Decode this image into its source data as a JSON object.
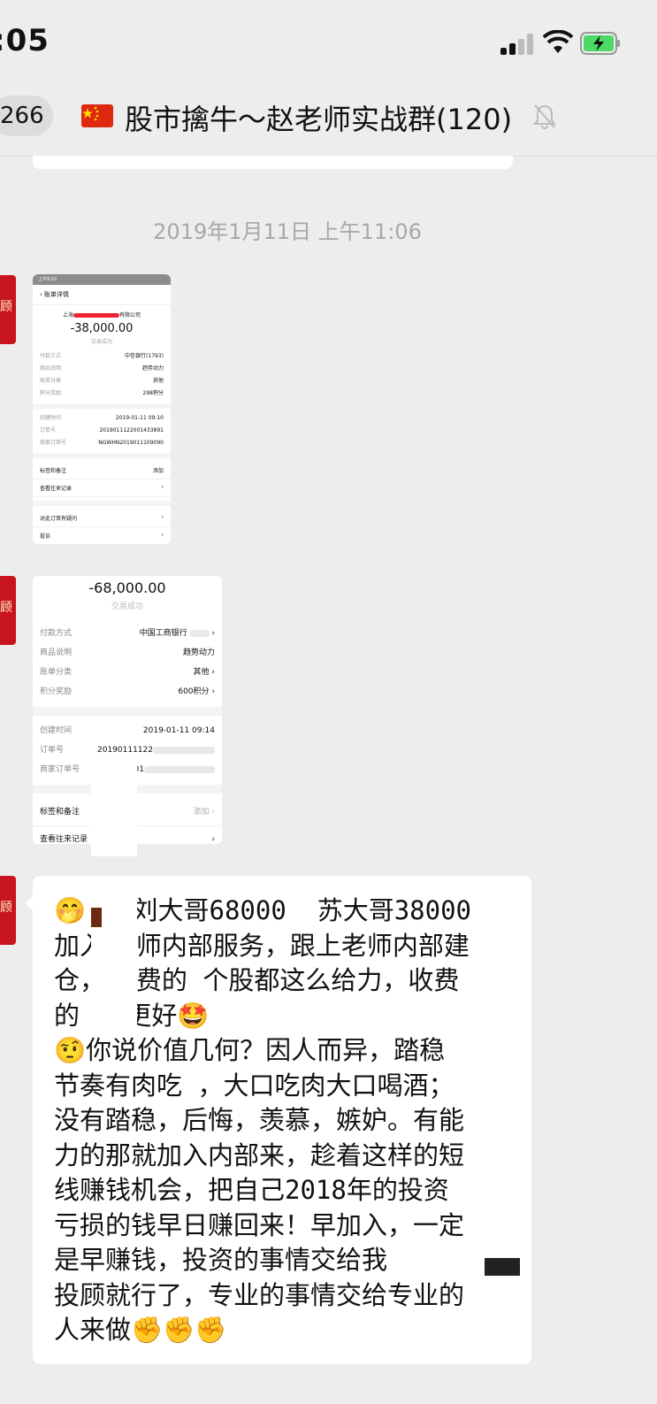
{
  "status_bar": {
    "time": ":05"
  },
  "nav": {
    "unread_count": "266",
    "flag_icon": "china-flag-icon",
    "title": "股市擒牛～赵老师实战群(120)",
    "mute_icon": "bell-muted-icon"
  },
  "timestamp": "2019年1月11日 上午11:06",
  "receipt1": {
    "status_time": "上午9:10",
    "title": "账单详情",
    "merchant": "上海",
    "merchant_suffix": "有限公司",
    "amount": "-38,000.00",
    "status": "交易成功",
    "rows": [
      {
        "k": "付款方式",
        "v": "中信银行(1793)"
      },
      {
        "k": "商品说明",
        "v": "趋势动力"
      },
      {
        "k": "账单分类",
        "v": "其他"
      },
      {
        "k": "积分奖励",
        "v": "298积分"
      }
    ],
    "rows2": [
      {
        "k": "创建时间",
        "v": "2019-01-11 09:10"
      },
      {
        "k": "订单号",
        "v": "2019011122001433891"
      },
      {
        "k": "商家订单号",
        "v": "NGWHN2019011109090"
      }
    ],
    "links": [
      {
        "label": "标签和备注",
        "right": "添加"
      },
      {
        "label": "查看往来记录",
        "right": ""
      },
      {
        "label": "对此订单有疑问",
        "right": ""
      },
      {
        "label": "投诉",
        "right": ""
      }
    ]
  },
  "receipt2": {
    "amount": "-68,000.00",
    "status": "交易成功",
    "rows": [
      {
        "k": "付款方式",
        "v": "中国工商银行"
      },
      {
        "k": "商品说明",
        "v": "趋势动力"
      },
      {
        "k": "账单分类",
        "v": "其他"
      },
      {
        "k": "积分奖励",
        "v": "600积分"
      }
    ],
    "rows2": [
      {
        "k": "创建时间",
        "v": "2019-01-11 09:14"
      },
      {
        "k": "订单号",
        "v": "20190111122"
      },
      {
        "k": "商家订单号",
        "v": "B201"
      }
    ],
    "links": [
      {
        "label": "标签和备注",
        "right": "添加"
      },
      {
        "label": "查看往来记录",
        "right": ""
      }
    ]
  },
  "message": {
    "text": "🤭   刘大哥68000  苏大哥38000\n加入  师内部服务，跟上老师内部建\n仓，  费的 个股都这么给力，收费\n的   更好🤩\n🤨你说价值几何？因人而异，踏稳\n节奏有肉吃 ，大口吃肉大口喝酒；\n没有踏稳，后悔，羡慕，嫉妒。有能\n力的那就加入内部来，趁着这样的短\n线赚钱机会，把自己2018年的投资\n亏损的钱早日赚回来！早加入，一定\n是早赚钱，投资的事情交给我\n投顾就行了，专业的事情交给专业的\n人来做✊✊✊"
  },
  "avatar_text": "顾",
  "colors": {
    "background": "#ededed",
    "bubble": "#ffffff",
    "avatar_red": "#c8141c",
    "battery_green": "#4cd964"
  }
}
